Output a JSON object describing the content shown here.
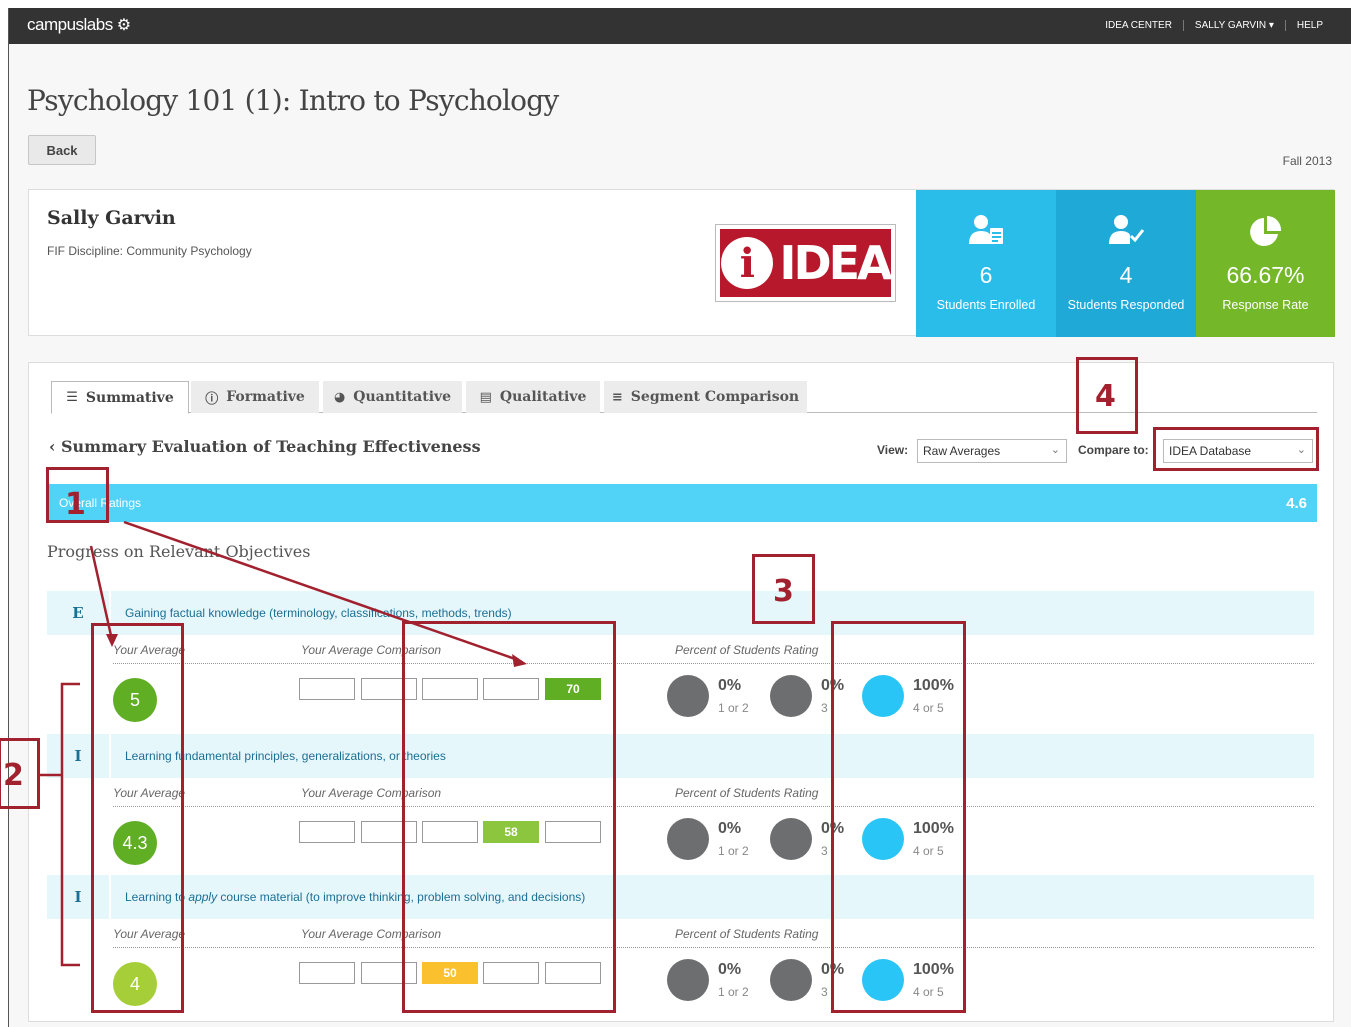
{
  "topbar": {
    "logo": "campuslabs",
    "logo_icon": "network-gear-icon",
    "nav": [
      "IDEA CENTER",
      "SALLY GARVIN ▾",
      "HELP"
    ]
  },
  "page": {
    "title": "Psychology 101 (1): Intro to Psychology",
    "back_label": "Back",
    "term": "Fall 2013"
  },
  "instructor": {
    "name": "Sally Garvin",
    "discipline": "FIF Discipline: Community Psychology",
    "logo_text": "IDEA",
    "logo_letter": "i"
  },
  "stats": [
    {
      "icon": "user-clipboard-icon",
      "value": "6",
      "label": "Students Enrolled",
      "color": "#2bbde9"
    },
    {
      "icon": "user-check-icon",
      "value": "4",
      "label": "Students Responded",
      "color": "#1ea9d7"
    },
    {
      "icon": "pie-chart-icon",
      "value": "66.67%",
      "label": "Response Rate",
      "color": "#74b82a"
    }
  ],
  "tabs": [
    {
      "label": "Summative",
      "icon": "bar-list-icon",
      "active": true
    },
    {
      "label": "Formative",
      "icon": "info-circle-icon"
    },
    {
      "label": "Quantitative",
      "icon": "pie-icon"
    },
    {
      "label": "Qualitative",
      "icon": "list-box-icon"
    },
    {
      "label": "Segment Comparison",
      "icon": "sliders-icon"
    }
  ],
  "section": {
    "title": "Summary Evaluation of Teaching Effectiveness",
    "view_label": "View:",
    "view_value": "Raw Averages",
    "compare_label": "Compare to:",
    "compare_value": "IDEA Database"
  },
  "overall": {
    "label": "Overall Ratings",
    "value": "4.6"
  },
  "progress_title": "Progress on Relevant Objectives",
  "column_headers": {
    "avg": "Your Average",
    "comparison": "Your Average Comparison",
    "percent": "Percent of Students Rating"
  },
  "objectives": [
    {
      "code": "E",
      "text_pre": "Gaining factual knowledge (terminology, classifications, methods, trends)",
      "text_em": "",
      "text_post": "",
      "average": "5",
      "avg_color": "#5fae24",
      "comparison": {
        "position": 4,
        "value": "70",
        "color": "#5fae24"
      },
      "percents": [
        {
          "value": "0%",
          "label": "1 or 2"
        },
        {
          "value": "0%",
          "label": "3"
        },
        {
          "value": "100%",
          "label": "4 or 5"
        }
      ]
    },
    {
      "code": "I",
      "text_pre": "Learning fundamental principles, generalizations, or theories",
      "text_em": "",
      "text_post": "",
      "average": "4.3",
      "avg_color": "#5fae24",
      "comparison": {
        "position": 3,
        "value": "58",
        "color": "#8cc63e"
      },
      "percents": [
        {
          "value": "0%",
          "label": "1 or 2"
        },
        {
          "value": "0%",
          "label": "3"
        },
        {
          "value": "100%",
          "label": "4 or 5"
        }
      ]
    },
    {
      "code": "I",
      "text_pre": "Learning to ",
      "text_em": "apply",
      "text_post": " course material (to improve thinking, problem solving, and decisions)",
      "average": "4",
      "avg_color": "#a6ce39",
      "comparison": {
        "position": 2,
        "value": "50",
        "color": "#fbc02d"
      },
      "percents": [
        {
          "value": "0%",
          "label": "1 or 2"
        },
        {
          "value": "0%",
          "label": "3"
        },
        {
          "value": "100%",
          "label": "4 or 5"
        }
      ]
    }
  ],
  "annotations": [
    "1",
    "2",
    "3",
    "4"
  ],
  "colors": {
    "accent": "#50d3f7",
    "annotation": "#a1212f",
    "gray_circle": "#6d6e70",
    "blue_circle": "#29c5f6"
  }
}
